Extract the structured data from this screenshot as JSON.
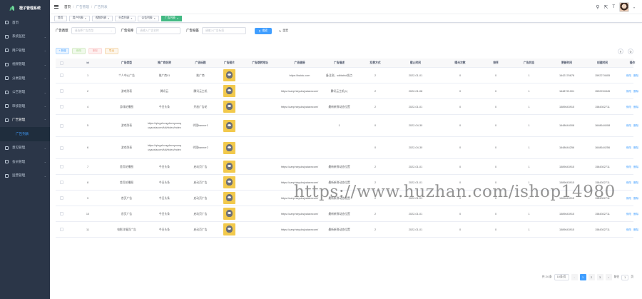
{
  "sidebar": {
    "brand": "橙子管理系统",
    "items": [
      {
        "label": "首页",
        "icon": "home-icon"
      },
      {
        "label": "系统监控",
        "icon": "monitor-icon"
      },
      {
        "label": "用户管理",
        "icon": "user-icon"
      },
      {
        "label": "视频管理",
        "icon": "video-icon"
      },
      {
        "label": "分类管理",
        "icon": "category-icon"
      },
      {
        "label": "公告管理",
        "icon": "notice-icon"
      },
      {
        "label": "审核管理",
        "icon": "audit-icon"
      },
      {
        "label": "广告管理",
        "icon": "ad-icon"
      }
    ],
    "submenu": "广告列表",
    "items_after": [
      {
        "label": "意见管理",
        "icon": "feedback-icon"
      },
      {
        "label": "会员管理",
        "icon": "member-icon"
      },
      {
        "label": "运营管理",
        "icon": "operation-icon"
      }
    ]
  },
  "topbar": {
    "breadcrumb": [
      "首页",
      "广告管理",
      "广告列表"
    ]
  },
  "tagsview": {
    "tags": [
      "首页",
      "用户列表",
      "视频列表",
      "分类列表",
      "公告列表",
      "广告列表"
    ]
  },
  "filter": {
    "type_label": "广告类型",
    "type_placeholder": "请选择广告类型",
    "name_label": "广告名称",
    "name_placeholder": "请输入广告名称",
    "tag_label": "广告标签",
    "tag_placeholder": "请输入广告标签",
    "search_label": "搜索",
    "reset_label": "重置"
  },
  "actions": {
    "add": "+ 新增",
    "edit": "修改",
    "delete": "删除",
    "export": "导出"
  },
  "table": {
    "headers": [
      "",
      "id",
      "广告类型",
      "推广商名称",
      "广告标题",
      "广告图片",
      "广告跳转地址",
      "广告链接",
      "广告描述",
      "扣费方式",
      "截止时间",
      "曝光次数",
      "排序",
      "广告状态",
      "更新时间",
      "创建时间",
      "操作"
    ],
    "rows": [
      {
        "id": "1",
        "type": "个人中心广告",
        "vendor": "推广商01",
        "title": "推广商",
        "jump": "",
        "link": "https://baidu.com",
        "desc": "备注测，sdfdsfsd发点",
        "fee": "2",
        "deadline": "2022-01-01",
        "views": "0",
        "sort": "0",
        "status": "1",
        "updated": "1642176678",
        "created": "1592274605"
      },
      {
        "id": "2",
        "type": "游戏列表",
        "vendor": "腾讯云",
        "title": "腾讯云主机",
        "jump": "",
        "link": "https://aznphixyuksjxaiaxncom/",
        "desc": "腾讯云主机(1)",
        "fee": "2",
        "deadline": "2022-01-08",
        "views": "0",
        "sort": "0",
        "status": "1",
        "updated": "1648721001",
        "created": "1592294345"
      },
      {
        "id": "4",
        "type": "游戏轮播图",
        "vendor": "今日头条",
        "title": "开放广告轮",
        "jump": "",
        "link": "https://aznphixyuksjxaiaxncom/",
        "desc": "最新新鲜动态位置",
        "fee": "2",
        "deadline": "2022-01-01",
        "views": "0",
        "sort": "0",
        "status": "1",
        "updated": "1589643915",
        "created": "1584302711"
      },
      {
        "id": "5",
        "type": "游戏列表",
        "vendor": "https://qingzhongdevnyounquyaoxiacom/fuli/video/index",
        "title": "代理banner1",
        "jump": "",
        "link": "",
        "desc": "1",
        "fee": "0",
        "deadline": "2022-04-30",
        "views": "0",
        "sort": "0",
        "status": "1",
        "updated": "1648644008",
        "created": "1648644008"
      },
      {
        "id": "6",
        "type": "游戏列表",
        "vendor": "https://qingzhongdevnyounquyaoxiacom/fuli/video/index",
        "title": "代理banner2",
        "jump": "",
        "link": "",
        "desc": "",
        "fee": "0",
        "deadline": "2022-04-30",
        "views": "0",
        "sort": "0",
        "status": "1",
        "updated": "1648644256",
        "created": "1648644256"
      },
      {
        "id": "7",
        "type": "首页轮播图",
        "vendor": "今日头条",
        "title": "启动页广告",
        "jump": "",
        "link": "https://aznphixyuksjxaiaxncom/",
        "desc": "最新新鲜动态位置",
        "fee": "2",
        "deadline": "2022-01-01",
        "views": "0",
        "sort": "0",
        "status": "1",
        "updated": "1589643915",
        "created": "1584302711"
      },
      {
        "id": "8",
        "type": "首页轮播图",
        "vendor": "今日头条",
        "title": "启动页广告",
        "jump": "",
        "link": "https://aznphixyuksjxaiaxncom/",
        "desc": "最新新鲜动态位置",
        "fee": "2",
        "deadline": "2022-01-01",
        "views": "0",
        "sort": "0",
        "status": "1",
        "updated": "1589643915",
        "created": "1584302711"
      },
      {
        "id": "9",
        "type": "首页广告",
        "vendor": "今日头条",
        "title": "启动页广告",
        "jump": "",
        "link": "https://aznphixyuksjxaiaxncom/",
        "desc": "最新新鲜动态位置",
        "fee": "2",
        "deadline": "2022-01-01",
        "views": "0",
        "sort": "0",
        "status": "1",
        "updated": "1589643915",
        "created": "1584302711"
      },
      {
        "id": "10",
        "type": "首页广告",
        "vendor": "今日头条",
        "title": "启动页广告",
        "jump": "",
        "link": "https://aznphixyuksjxaiaxncom/",
        "desc": "最新新鲜动态位置",
        "fee": "2",
        "deadline": "2022-01-01",
        "views": "0",
        "sort": "0",
        "status": "1",
        "updated": "1589643915",
        "created": "1584302711"
      },
      {
        "id": "11",
        "type": "电影详情页广告",
        "vendor": "今日头条",
        "title": "启动页广告",
        "jump": "",
        "link": "https://aznphixyuksjxaiaxncom/",
        "desc": "最新新鲜动态位置",
        "fee": "2",
        "deadline": "2022-01-01",
        "views": "0",
        "sort": "0",
        "status": "1",
        "updated": "1589643915",
        "created": "1584302711"
      }
    ],
    "op_edit": "修改",
    "op_delete": "删除"
  },
  "pagination": {
    "total": "共 24 条",
    "page_size": "10条/页",
    "pages": [
      "1",
      "2",
      "3"
    ],
    "jump_label": "前往",
    "jump_value": "1",
    "page_unit": "页"
  },
  "watermark": "https://www.huzhan.com/ishop14980"
}
